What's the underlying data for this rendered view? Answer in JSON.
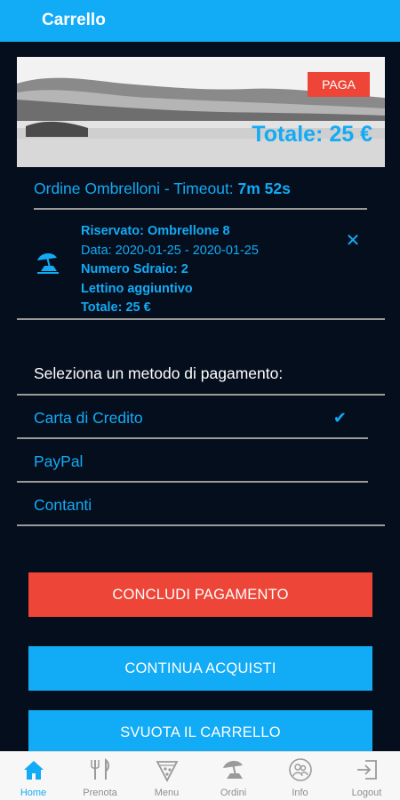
{
  "header": {
    "title": "Carrello"
  },
  "hero": {
    "pay_badge": "PAGA",
    "total": "Totale: 25 €"
  },
  "order": {
    "title_prefix": "Ordine Ombrelloni - Timeout: ",
    "timeout": "7m 52s"
  },
  "cart_item": {
    "icon": "beach-umbrella-icon",
    "reserved": "Riservato: Ombrellone 8",
    "dates": "Data: 2020-01-25 - 2020-01-25",
    "loungers": "Numero Sdraio: 2",
    "extra": "Lettino aggiuntivo",
    "total": "Totale: 25 €",
    "remove_icon": "close-icon"
  },
  "payment": {
    "heading": "Seleziona un metodo di pagamento:",
    "methods": [
      {
        "label": "Carta di Credito",
        "selected": true
      },
      {
        "label": "PayPal",
        "selected": false
      },
      {
        "label": "Contanti",
        "selected": false
      }
    ],
    "check_mark": "✔"
  },
  "actions": {
    "complete": "CONCLUDI PAGAMENTO",
    "continue": "CONTINUA ACQUISTI",
    "empty_cart": "SVUOTA IL CARRELLO"
  },
  "tabs": [
    {
      "label": "Home",
      "icon": "home-icon",
      "active": true
    },
    {
      "label": "Prenota",
      "icon": "cutlery-icon",
      "active": false
    },
    {
      "label": "Menu",
      "icon": "pizza-icon",
      "active": false
    },
    {
      "label": "Ordini",
      "icon": "beach-umbrella-icon",
      "active": false
    },
    {
      "label": "Info",
      "icon": "info-people-icon",
      "active": false
    },
    {
      "label": "Logout",
      "icon": "logout-icon",
      "active": false
    }
  ],
  "colors": {
    "accent": "#12abf6",
    "danger": "#ed4638",
    "background": "#050e1c",
    "divider": "#9a9a9a"
  }
}
